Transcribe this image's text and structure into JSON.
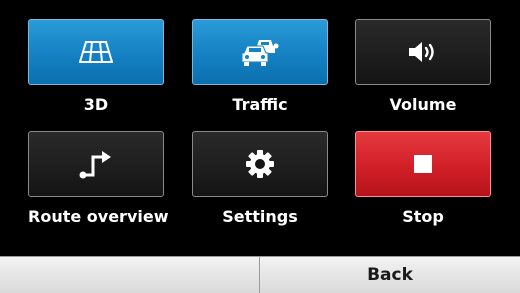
{
  "menu": {
    "items": [
      {
        "label": "3D",
        "icon": "3d-grid-icon",
        "color": "#1683c4"
      },
      {
        "label": "Traffic",
        "icon": "traffic-cars-icon",
        "color": "#1683c4"
      },
      {
        "label": "Volume",
        "icon": "speaker-icon",
        "color": "#141414"
      },
      {
        "label": "Route overview",
        "icon": "route-arrow-icon",
        "color": "#141414"
      },
      {
        "label": "Settings",
        "icon": "gear-icon",
        "color": "#141414"
      },
      {
        "label": "Stop",
        "icon": "stop-square-icon",
        "color": "#d11f27"
      }
    ]
  },
  "bottom_bar": {
    "back_label": "Back"
  }
}
